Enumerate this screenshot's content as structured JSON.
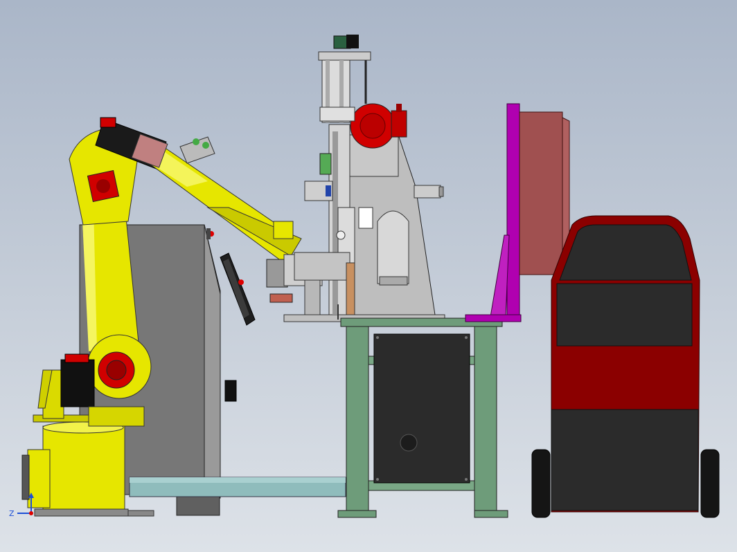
{
  "viewport": {
    "background_top": "#aab6c8",
    "background_bottom": "#dde2e8"
  },
  "colors": {
    "robot_yellow": "#e6e600",
    "robot_red": "#d00000",
    "cabinet_gray": "#707070",
    "table_green": "#6e9c7a",
    "press_gray": "#bebebe",
    "cart_red": "#8b0000",
    "cart_black": "#2b2b2b",
    "magenta": "#b000b0",
    "rose_panel": "#a05050",
    "rail_teal": "#8fbcbc"
  },
  "triad": {
    "z_label": "Z"
  }
}
